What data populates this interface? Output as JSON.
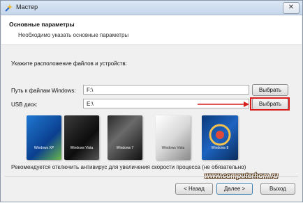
{
  "window": {
    "title": "Мастер",
    "close_label": "✕"
  },
  "header": {
    "title": "Основные параметры",
    "subtitle": "Необходимо указать основные параметры"
  },
  "main": {
    "prompt": "Укажите расположение файлов и устройств:",
    "windows_path": {
      "label": "Путь к файлам Windows:",
      "value": "F:\\",
      "button": "Выбрать"
    },
    "usb": {
      "label": "USB диск:",
      "value": "E:\\",
      "button": "Выбрать"
    },
    "os_boxes": [
      {
        "name": "windows-xp",
        "label": "Windows XP"
      },
      {
        "name": "windows-vista-dark",
        "label": "Windows Vista"
      },
      {
        "name": "windows-7",
        "label": "Windows 7"
      },
      {
        "name": "windows-vista-light",
        "label": "Windows Vista"
      },
      {
        "name": "windows-8",
        "label": "Windows 8"
      }
    ],
    "note": "Рекомендуется отключить антивирус для увеличения скорости процесса (не обязательно)"
  },
  "watermark": "www.computerhom.ru",
  "footer": {
    "back": "< Назад",
    "next": "Далее >",
    "exit": "Выход"
  },
  "colors": {
    "highlight": "#d81b1b",
    "accent": "#1f5fa8"
  }
}
